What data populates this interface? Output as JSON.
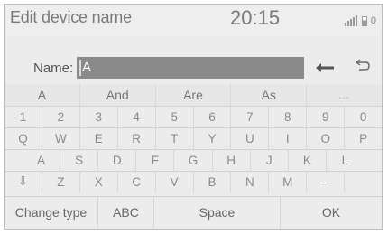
{
  "header": {
    "title": "Edit device name",
    "clock": "20:15",
    "status_number": "0"
  },
  "name_input": {
    "label": "Name:",
    "value": "A"
  },
  "icons": {
    "backspace": "backspace-arrow-icon",
    "undo": "undo-arrow-icon",
    "shift": "shift-icon",
    "signal": "signal-icon",
    "battery": "battery-icon"
  },
  "predictions": [
    "A",
    "And",
    "Are",
    "As",
    "..."
  ],
  "keyboard": {
    "numbers": [
      "1",
      "2",
      "3",
      "4",
      "5",
      "6",
      "7",
      "8",
      "9",
      "0"
    ],
    "row_q": [
      "Q",
      "W",
      "E",
      "R",
      "T",
      "Y",
      "U",
      "I",
      "O",
      "P"
    ],
    "row_a": [
      "A",
      "S",
      "D",
      "F",
      "G",
      "H",
      "J",
      "K",
      "L"
    ],
    "row_z": [
      "⇩",
      "Z",
      "X",
      "C",
      "V",
      "B",
      "N",
      "M",
      "–",
      ""
    ]
  },
  "bottom_bar": {
    "change_type": "Change type",
    "abc": "ABC",
    "space": "Space",
    "ok": "OK"
  }
}
